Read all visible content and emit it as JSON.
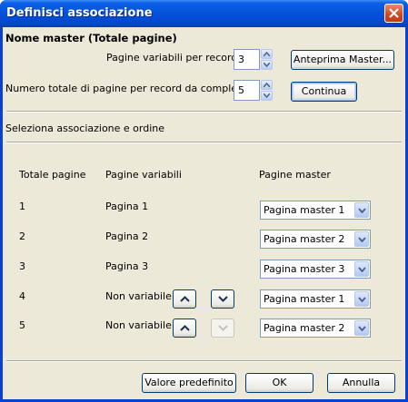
{
  "window": {
    "title": "Definisci associazione"
  },
  "header": {
    "section_title": "Nome master (Totale pagine)"
  },
  "settings": {
    "variable_pages_label": "Pagine variabili per record:",
    "variable_pages_value": "3",
    "total_pages_label": "Numero totale di pagine per record da completare:",
    "total_pages_value": "5",
    "preview_button": "Anteprima Master...",
    "continue_button": "Continua"
  },
  "mapping": {
    "section_label": "Seleziona associazione e ordine",
    "columns": {
      "total": "Totale pagine",
      "variable": "Pagine variabili",
      "master": "Pagine master"
    },
    "rows": [
      {
        "total": "1",
        "variable": "Pagina 1",
        "master": "Pagina master 1",
        "move_buttons": false
      },
      {
        "total": "2",
        "variable": "Pagina 2",
        "master": "Pagina master 2",
        "move_buttons": false
      },
      {
        "total": "3",
        "variable": "Pagina 3",
        "master": "Pagina master 3",
        "move_buttons": false
      },
      {
        "total": "4",
        "variable": "Non variabile",
        "master": "Pagina master 1",
        "move_buttons": true,
        "down_enabled": true
      },
      {
        "total": "5",
        "variable": "Non variabile",
        "master": "Pagina master 2",
        "move_buttons": true,
        "down_enabled": false
      }
    ]
  },
  "footer": {
    "default_button": "Valore predefinito",
    "ok_button": "OK",
    "cancel_button": "Annulla"
  },
  "icons": {
    "close": "close-icon",
    "spin_up": "chevron-up-icon",
    "spin_down": "chevron-down-icon",
    "dropdown": "dropdown-arrow-icon",
    "move_up": "move-up-icon",
    "move_down": "move-down-icon"
  },
  "colors": {
    "titlebar": "#0553dc",
    "dialog_bg": "#ece9d8",
    "close_button": "#d2451d"
  }
}
